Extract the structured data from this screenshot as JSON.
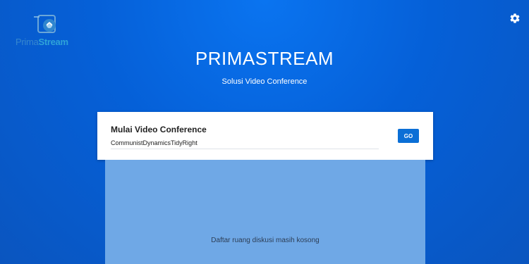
{
  "header": {
    "logo_text_light": "Prima",
    "logo_text_bold": "Stream",
    "title": "PRIMASTREAM",
    "subtitle": "Solusi Video Conference",
    "settings_icon": "gear-icon"
  },
  "card": {
    "title": "Mulai Video Conference",
    "room_input_value": "CommunistDynamicsTidyRight",
    "go_label": "GO"
  },
  "room_list": {
    "empty_message": "Daftar ruang diskusi masih kosong"
  },
  "colors": {
    "background": "#0560d8",
    "accent_button": "#0b6fd6",
    "list_panel": "#6fa8e6"
  }
}
